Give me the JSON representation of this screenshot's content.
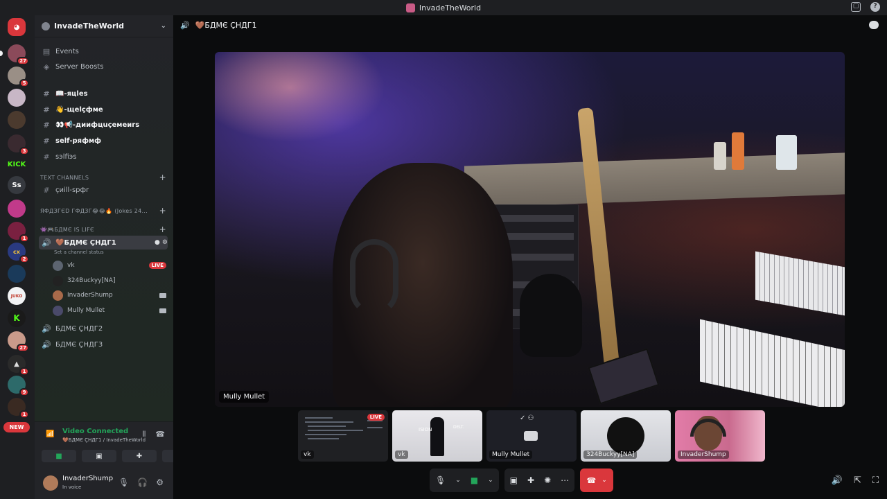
{
  "window": {
    "title": "InvadeTheWorld"
  },
  "rail": {
    "badges": [
      "27",
      "5",
      "3",
      "1",
      "2",
      "27",
      "1",
      "9",
      "1"
    ],
    "kick_label": "KICK",
    "ss_label": "Ss",
    "juko_label": "JUKO",
    "new_label": "NEW"
  },
  "server": {
    "name": "InvadeTheWorld"
  },
  "sidebar": {
    "events": "Events",
    "boosts": "Server Boosts",
    "channels": [
      {
        "label": "📖-яцles"
      },
      {
        "label": "👋-щelçфмe"
      },
      {
        "label": "👀📢-диифцuçемeиrs"
      },
      {
        "label": "self-ряфмф"
      },
      {
        "label": "sэlfiэs"
      }
    ],
    "cat_text": "TEXT CHANNELS",
    "chill": "çиill-sрфr",
    "cat_jokes": "ЯФДЗГЄD ГФДЗГ😂😂🔥 (Jokes 24...",
    "cat_game": "👾🎮БДМЄ IS LIFЄ",
    "active_voice": "🤎БДМЄ ÇНДГ1",
    "channel_status": "Set a channel status",
    "voice_users": [
      {
        "name": "vk",
        "live": "LIVE"
      },
      {
        "name": "324Buckyy[NA]"
      },
      {
        "name": "InvaderShump"
      },
      {
        "name": "Mully Mullet"
      }
    ],
    "voice2": "БДМЄ ÇНДГ2",
    "voice3": "БДМЄ ÇНДГ3"
  },
  "voice_panel": {
    "status": "Video Connected",
    "location": "🤎БДМЄ ÇНДГ1 / InvadeTheWorld"
  },
  "user_panel": {
    "name": "InvaderShump",
    "status": "In voice"
  },
  "stage": {
    "channel_title": "🤎БДМЄ ÇНДГ1",
    "main_name": "Mully Mullet",
    "thumbs": [
      {
        "label": "vk",
        "live": "LIVE"
      },
      {
        "label": "vk",
        "text1": "ISION",
        "text2": "DELT."
      },
      {
        "label": "Mully Mullet"
      },
      {
        "label": "324Buckyy[NA]"
      },
      {
        "label": "InvaderShump"
      }
    ]
  },
  "colors": {
    "accent": "#23a55a",
    "danger": "#da373c",
    "bg": "#111214"
  }
}
